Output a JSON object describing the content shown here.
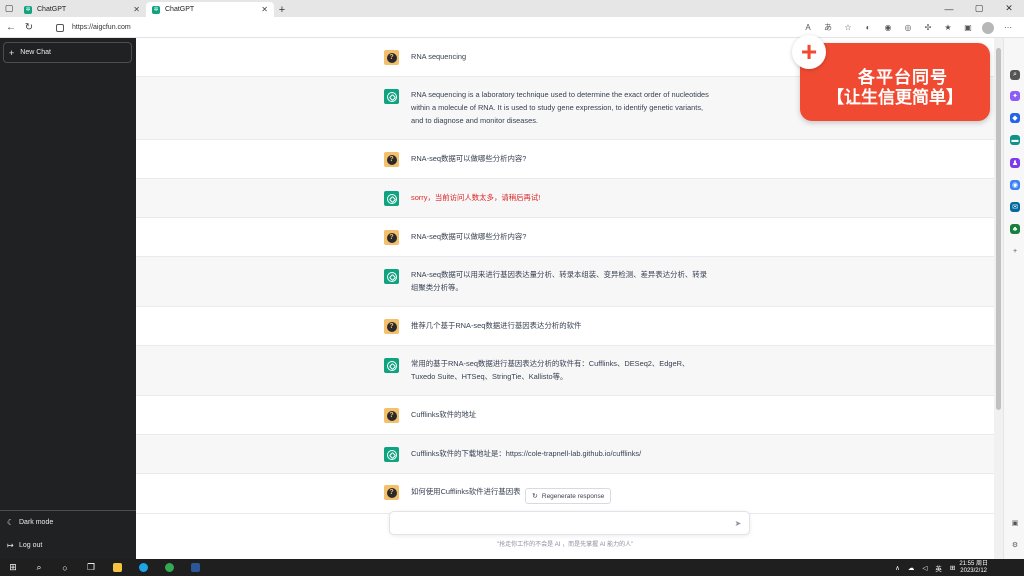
{
  "browser": {
    "tabs": [
      {
        "label": "ChatGPT",
        "active": false
      },
      {
        "label": "ChatGPT",
        "active": true
      }
    ],
    "url": "https://aigcfun.com"
  },
  "sidebar": {
    "new_chat": "New Chat",
    "dark_mode": "Dark mode",
    "log_out": "Log out"
  },
  "messages": [
    {
      "role": "user",
      "text": "RNA sequencing"
    },
    {
      "role": "bot",
      "text": "RNA sequencing is a laboratory technique used to determine the exact order of nucleotides within a molecule of RNA. It is used to study gene expression, to identify genetic variants, and to diagnose and monitor diseases."
    },
    {
      "role": "user",
      "text": "RNA-seq数据可以做哪些分析内容?"
    },
    {
      "role": "bot",
      "text": "sorry，当前访问人数太多，请稍后再试!",
      "error": true
    },
    {
      "role": "user",
      "text": "RNA-seq数据可以做哪些分析内容?"
    },
    {
      "role": "bot",
      "text": "RNA-seq数据可以用来进行基因表达量分析、转录本组装、变异检测、差异表达分析、转录组聚类分析等。"
    },
    {
      "role": "user",
      "text": "推荐几个基于RNA-seq数据进行基因表达分析的软件"
    },
    {
      "role": "bot",
      "text": "常用的基于RNA-seq数据进行基因表达分析的软件有：Cufflinks、DESeq2、EdgeR、Tuxedo Suite、HTSeq、StringTie、Kallisto等。"
    },
    {
      "role": "user",
      "text": "Cufflinks软件的地址"
    },
    {
      "role": "bot",
      "text": "Cufflinks软件的下载地址是：https://cole-trapnell-lab.github.io/cufflinks/"
    },
    {
      "role": "user",
      "text": "如何使用Cufflinks软件进行基因表"
    }
  ],
  "regenerate": "Regenerate response",
  "input": {
    "value": "",
    "placeholder": ""
  },
  "footer_note": "\"抢走你工作的不会是 AI ，而是先掌握 AI 能力的人\"",
  "promo": {
    "line1": "各平台同号",
    "line2": "【让生信更简单】"
  },
  "taskbar": {
    "lang": "英",
    "time": "21:55 周日",
    "date": "2023/2/12"
  },
  "colors": {
    "sidebar": "#202123",
    "bot_bg": "#f7f7f8",
    "bot_avatar": "#10a37f",
    "user_avatar": "#f3c06d",
    "error": "#dc2626",
    "promo": "#f04b32"
  }
}
